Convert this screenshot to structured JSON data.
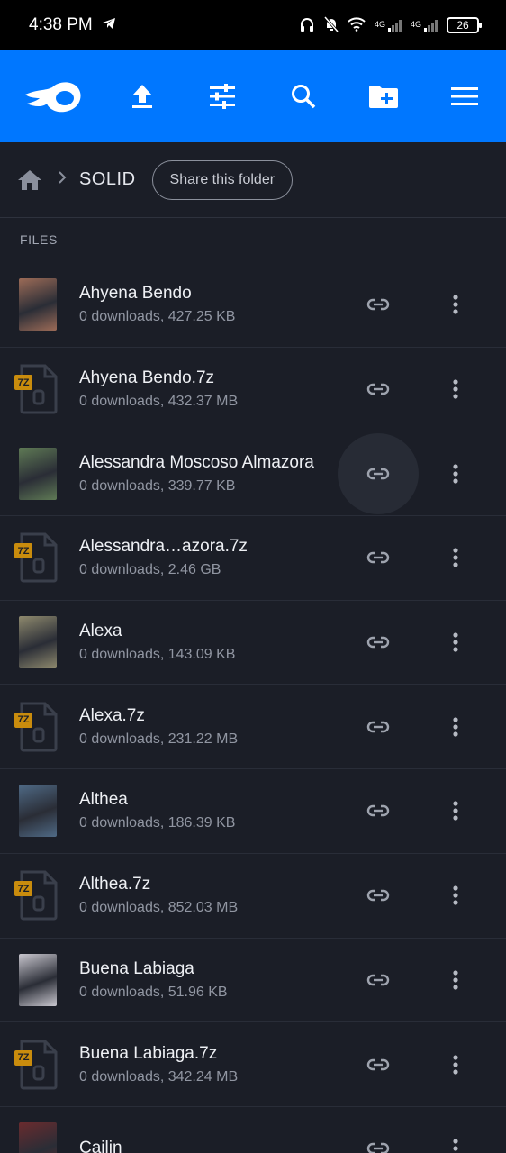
{
  "status_bar": {
    "time": "4:38 PM",
    "net1": "4G",
    "net2": "4G",
    "battery": "26"
  },
  "app_bar": {
    "icons": [
      "logo-icon",
      "upload-icon",
      "filter-icon",
      "search-icon",
      "new-folder-icon",
      "menu-icon"
    ],
    "color": "#0077ff"
  },
  "breadcrumb": {
    "folder": "SOLID",
    "share_label": "Share this folder"
  },
  "section_label": "FILES",
  "files": [
    {
      "name": "Ahyena Bendo",
      "meta": "0 downloads, 427.25 KB",
      "type": "image",
      "tint": "#9c6b57"
    },
    {
      "name": "Ahyena Bendo.7z",
      "meta": "0 downloads, 432.37 MB",
      "type": "archive"
    },
    {
      "name": "Alessandra Moscoso Almazora",
      "meta": "0 downloads, 339.77 KB",
      "type": "image",
      "tint": "#5f7a55"
    },
    {
      "name": "Alessandra…azora.7z",
      "meta": "0 downloads, 2.46 GB",
      "type": "archive"
    },
    {
      "name": "Alexa",
      "meta": "0 downloads, 143.09 KB",
      "type": "image",
      "tint": "#8f8a6e"
    },
    {
      "name": "Alexa.7z",
      "meta": "0 downloads, 231.22 MB",
      "type": "archive"
    },
    {
      "name": "Althea",
      "meta": "0 downloads, 186.39 KB",
      "type": "image",
      "tint": "#4f6a86"
    },
    {
      "name": "Althea.7z",
      "meta": "0 downloads, 852.03 MB",
      "type": "archive"
    },
    {
      "name": "Buena Labiaga",
      "meta": "0 downloads, 51.96 KB",
      "type": "image",
      "tint": "#c9c7cf"
    },
    {
      "name": "Buena Labiaga.7z",
      "meta": "0 downloads, 342.24 MB",
      "type": "archive"
    },
    {
      "name": "Cailin",
      "meta": "",
      "type": "image",
      "tint": "#6a2b2e"
    }
  ],
  "archive_badge": "7Z"
}
